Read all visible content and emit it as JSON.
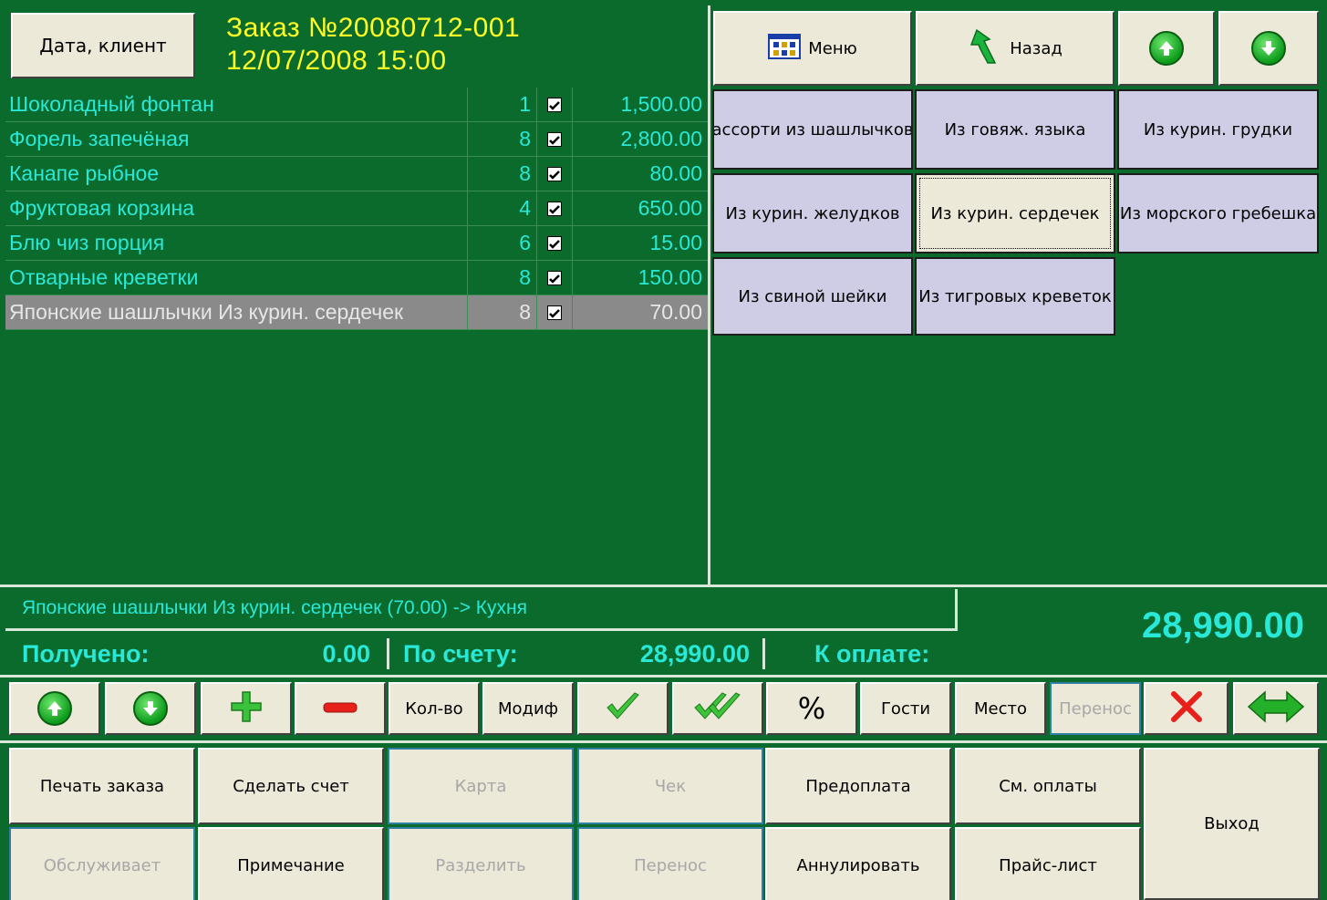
{
  "header": {
    "date_client_button": "Дата, клиент",
    "order_title": "Заказ №20080712-001",
    "order_datetime": "12/07/2008 15:00"
  },
  "order_items": [
    {
      "name": "Шоколадный фонтан",
      "qty": "1",
      "checked": true,
      "price": "1,500.00"
    },
    {
      "name": "Форель запечёная",
      "qty": "8",
      "checked": true,
      "price": "2,800.00"
    },
    {
      "name": "Канапе рыбное",
      "qty": "8",
      "checked": true,
      "price": "80.00"
    },
    {
      "name": "Фруктовая корзина",
      "qty": "4",
      "checked": true,
      "price": "650.00"
    },
    {
      "name": "Блю чиз порция",
      "qty": "6",
      "checked": true,
      "price": "15.00"
    },
    {
      "name": "Отварные креветки",
      "qty": "8",
      "checked": true,
      "price": "150.00"
    },
    {
      "name": "Японские шашлычки Из курин. сердечек",
      "qty": "8",
      "checked": true,
      "price": "70.00",
      "selected": true
    }
  ],
  "nav": {
    "menu_label": "Меню",
    "back_label": "Назад"
  },
  "categories": [
    {
      "label": "ассорти из шашлычков"
    },
    {
      "label": "Из говяж. языка"
    },
    {
      "label": "Из курин. грудки"
    },
    {
      "label": "Из курин. желудков"
    },
    {
      "label": "Из курин. сердечек",
      "selected": true
    },
    {
      "label": "Из морского гребешка"
    },
    {
      "label": "Из свиной шейки"
    },
    {
      "label": "Из тигровых креветок"
    }
  ],
  "status": {
    "info_line": "Японские шашлычки Из курин. сердечек (70.00) -> Кухня",
    "received_label": "Получено:",
    "received_value": "0.00",
    "bill_label": "По счету:",
    "bill_value": "28,990.00",
    "to_pay_label": "К оплате:",
    "to_pay_value": "28,990.00"
  },
  "toolbar": {
    "qty_label": "Кол-во",
    "modif_label": "Модиф",
    "percent_label": "%",
    "guests_label": "Гости",
    "place_label": "Место",
    "transfer_label": "Перенос"
  },
  "actions": {
    "print_order": "Печать заказа",
    "make_bill": "Сделать счет",
    "card": "Карта",
    "check": "Чек",
    "prepay": "Предоплата",
    "show_payments": "См. оплаты",
    "exit": "Выход",
    "serves": "Обслуживает",
    "note": "Примечание",
    "split": "Разделить",
    "transfer": "Перенос",
    "cancel": "Аннулировать",
    "price_list": "Прайс-лист"
  },
  "colors": {
    "background": "#0b6b2c",
    "accent_text": "#28e8d8",
    "title_text": "#ffff24",
    "button_face": "#ece9d8",
    "category_face": "#cfcde6"
  }
}
